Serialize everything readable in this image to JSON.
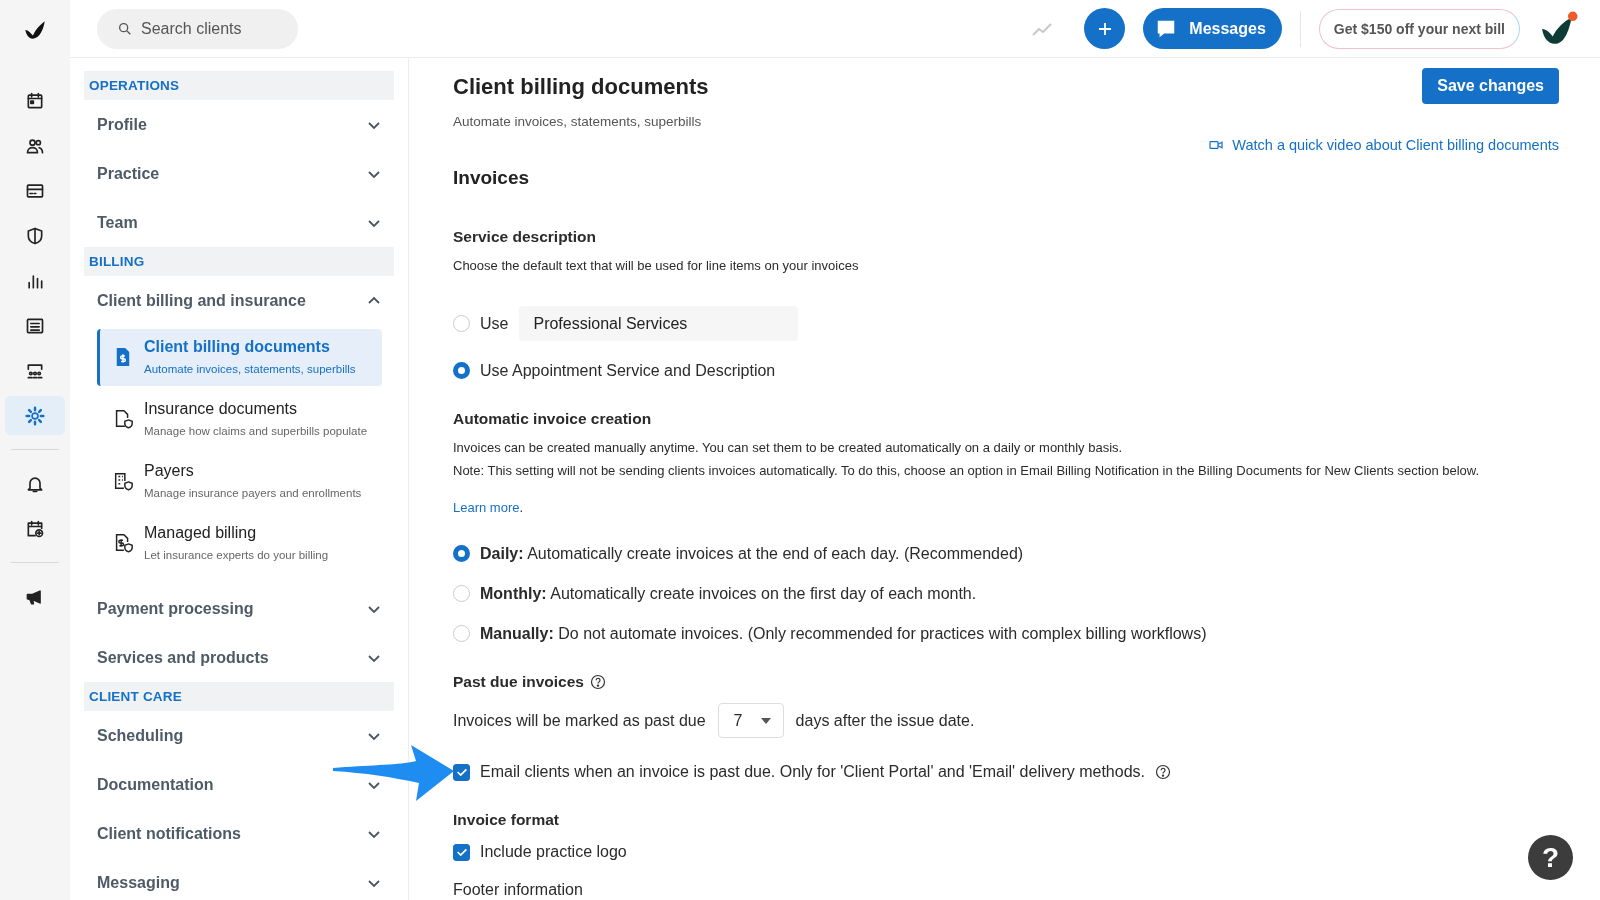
{
  "top_bar": {
    "search": {
      "placeholder": "Search clients"
    },
    "messages_button": "Messages",
    "promo_button": "Get $150 off your next bill",
    "avatar_notification": true
  },
  "rail": {
    "groups": [
      [
        {
          "selected": false
        },
        {
          "selected": false
        },
        {
          "selected": false
        },
        {
          "selected": false
        },
        {
          "selected": false
        },
        {
          "selected": false
        },
        {
          "selected": false
        },
        {
          "selected": true
        }
      ],
      [
        {
          "selected": false
        },
        {
          "selected": false
        }
      ],
      [
        {
          "selected": false
        }
      ]
    ]
  },
  "settings_nav": {
    "sections": [
      {
        "header": "OPERATIONS",
        "items": [
          {
            "label": "Profile",
            "expanded": false
          },
          {
            "label": "Practice",
            "expanded": false
          },
          {
            "label": "Team",
            "expanded": false
          }
        ]
      },
      {
        "header": "BILLING",
        "items": [
          {
            "label": "Client billing and insurance",
            "expanded": true,
            "children": [
              {
                "title": "Client billing documents",
                "subtitle": "Automate invoices, statements, superbills",
                "selected": true
              },
              {
                "title": "Insurance documents",
                "subtitle": "Manage how claims and superbills populate",
                "selected": false
              },
              {
                "title": "Payers",
                "subtitle": "Manage insurance payers and enrollments",
                "selected": false
              },
              {
                "title": "Managed billing",
                "subtitle": "Let insurance experts do your billing",
                "selected": false
              }
            ]
          },
          {
            "label": "Payment processing",
            "expanded": false
          },
          {
            "label": "Services and products",
            "expanded": false
          }
        ]
      },
      {
        "header": "CLIENT CARE",
        "items": [
          {
            "label": "Scheduling",
            "expanded": false
          },
          {
            "label": "Documentation",
            "expanded": false
          },
          {
            "label": "Client notifications",
            "expanded": false
          },
          {
            "label": "Messaging",
            "expanded": false
          }
        ]
      }
    ]
  },
  "page": {
    "title": "Client billing documents",
    "subtitle": "Automate invoices, statements, superbills",
    "save_button": "Save changes",
    "video_link": "Watch a quick video about Client billing documents",
    "section_title": "Invoices",
    "service_description": {
      "heading": "Service description",
      "text": "Choose the default text that will be used for line items on your invoices",
      "options": [
        {
          "kind": "field",
          "label": "Use",
          "value": "Professional Services",
          "selected": false
        },
        {
          "kind": "plain",
          "label": "Use Appointment Service and Description",
          "selected": true
        }
      ]
    },
    "automatic_creation": {
      "heading": "Automatic invoice creation",
      "text": "Invoices can be created manually anytime. You can set them to be created automatically on a daily or monthly basis.",
      "note": "Note: This setting will not be sending clients invoices automatically. To do this, choose an option in Email Billing Notification in the Billing Documents for New Clients section below.",
      "learn_more": {
        "link": "Learn more",
        "after": "."
      },
      "options": [
        {
          "label": "**Daily:** Automatically create invoices at the end of each day. (Recommended)",
          "selected": true
        },
        {
          "label": "**Monthly:** Automatically create invoices on the first day of each month.",
          "selected": false
        },
        {
          "label": "**Manually:** Do not automate invoices. (Only recommended for practices with complex billing workflows)",
          "selected": false
        }
      ]
    },
    "past_due": {
      "heading": "Past due invoices",
      "before": "Invoices will be marked as past due",
      "days": "7",
      "after": "days after the issue date.",
      "email_option": {
        "label": "Email clients when an invoice is past due. Only for 'Client Portal' and 'Email' delivery methods.",
        "checked": true
      }
    },
    "invoice_format": {
      "heading": "Invoice format",
      "logo_option": {
        "label": "Include practice logo",
        "checked": true
      },
      "footer_heading": "Footer information"
    }
  },
  "help_button": "?"
}
